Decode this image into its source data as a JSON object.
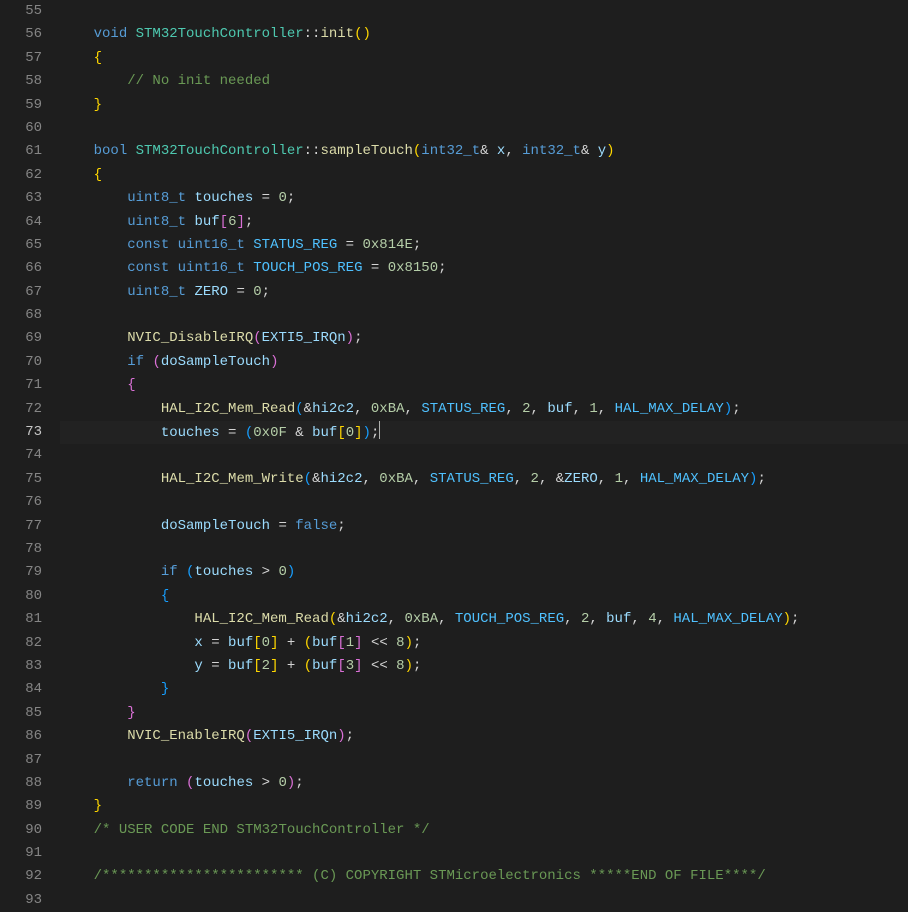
{
  "editor": {
    "startLine": 55,
    "activeLine": 73,
    "lines": [
      {
        "n": 55,
        "tokens": []
      },
      {
        "n": 56,
        "tokens": [
          {
            "t": "    ",
            "c": ""
          },
          {
            "t": "void",
            "c": "kw"
          },
          {
            "t": " ",
            "c": ""
          },
          {
            "t": "STM32TouchController",
            "c": "cls"
          },
          {
            "t": "::",
            "c": "pun"
          },
          {
            "t": "init",
            "c": "fn"
          },
          {
            "t": "()",
            "c": "brace"
          }
        ]
      },
      {
        "n": 57,
        "tokens": [
          {
            "t": "    ",
            "c": ""
          },
          {
            "t": "{",
            "c": "brace"
          }
        ]
      },
      {
        "n": 58,
        "tokens": [
          {
            "t": "        ",
            "c": ""
          },
          {
            "t": "// No init needed",
            "c": "com"
          }
        ]
      },
      {
        "n": 59,
        "tokens": [
          {
            "t": "    ",
            "c": ""
          },
          {
            "t": "}",
            "c": "brace"
          }
        ]
      },
      {
        "n": 60,
        "tokens": []
      },
      {
        "n": 61,
        "tokens": [
          {
            "t": "    ",
            "c": ""
          },
          {
            "t": "bool",
            "c": "kw"
          },
          {
            "t": " ",
            "c": ""
          },
          {
            "t": "STM32TouchController",
            "c": "cls"
          },
          {
            "t": "::",
            "c": "pun"
          },
          {
            "t": "sampleTouch",
            "c": "fn"
          },
          {
            "t": "(",
            "c": "brace"
          },
          {
            "t": "int32_t",
            "c": "type"
          },
          {
            "t": "&",
            "c": "op"
          },
          {
            "t": " ",
            "c": ""
          },
          {
            "t": "x",
            "c": "var"
          },
          {
            "t": ", ",
            "c": "pun"
          },
          {
            "t": "int32_t",
            "c": "type"
          },
          {
            "t": "&",
            "c": "op"
          },
          {
            "t": " ",
            "c": ""
          },
          {
            "t": "y",
            "c": "var"
          },
          {
            "t": ")",
            "c": "brace"
          }
        ]
      },
      {
        "n": 62,
        "tokens": [
          {
            "t": "    ",
            "c": ""
          },
          {
            "t": "{",
            "c": "brace"
          }
        ]
      },
      {
        "n": 63,
        "tokens": [
          {
            "t": "        ",
            "c": ""
          },
          {
            "t": "uint8_t",
            "c": "type"
          },
          {
            "t": " ",
            "c": ""
          },
          {
            "t": "touches",
            "c": "var"
          },
          {
            "t": " = ",
            "c": "op"
          },
          {
            "t": "0",
            "c": "num"
          },
          {
            "t": ";",
            "c": "pun"
          }
        ]
      },
      {
        "n": 64,
        "tokens": [
          {
            "t": "        ",
            "c": ""
          },
          {
            "t": "uint8_t",
            "c": "type"
          },
          {
            "t": " ",
            "c": ""
          },
          {
            "t": "buf",
            "c": "var"
          },
          {
            "t": "[",
            "c": "brace2"
          },
          {
            "t": "6",
            "c": "num"
          },
          {
            "t": "]",
            "c": "brace2"
          },
          {
            "t": ";",
            "c": "pun"
          }
        ]
      },
      {
        "n": 65,
        "tokens": [
          {
            "t": "        ",
            "c": ""
          },
          {
            "t": "const",
            "c": "kw"
          },
          {
            "t": " ",
            "c": ""
          },
          {
            "t": "uint16_t",
            "c": "type"
          },
          {
            "t": " ",
            "c": ""
          },
          {
            "t": "STATUS_REG",
            "c": "const"
          },
          {
            "t": " = ",
            "c": "op"
          },
          {
            "t": "0x814E",
            "c": "num"
          },
          {
            "t": ";",
            "c": "pun"
          }
        ]
      },
      {
        "n": 66,
        "tokens": [
          {
            "t": "        ",
            "c": ""
          },
          {
            "t": "const",
            "c": "kw"
          },
          {
            "t": " ",
            "c": ""
          },
          {
            "t": "uint16_t",
            "c": "type"
          },
          {
            "t": " ",
            "c": ""
          },
          {
            "t": "TOUCH_POS_REG",
            "c": "const"
          },
          {
            "t": " = ",
            "c": "op"
          },
          {
            "t": "0x8150",
            "c": "num"
          },
          {
            "t": ";",
            "c": "pun"
          }
        ]
      },
      {
        "n": 67,
        "tokens": [
          {
            "t": "        ",
            "c": ""
          },
          {
            "t": "uint8_t",
            "c": "type"
          },
          {
            "t": " ",
            "c": ""
          },
          {
            "t": "ZERO",
            "c": "var"
          },
          {
            "t": " = ",
            "c": "op"
          },
          {
            "t": "0",
            "c": "num"
          },
          {
            "t": ";",
            "c": "pun"
          }
        ]
      },
      {
        "n": 68,
        "tokens": []
      },
      {
        "n": 69,
        "tokens": [
          {
            "t": "        ",
            "c": ""
          },
          {
            "t": "NVIC_DisableIRQ",
            "c": "fn"
          },
          {
            "t": "(",
            "c": "brace2"
          },
          {
            "t": "EXTI5_IRQn",
            "c": "var"
          },
          {
            "t": ")",
            "c": "brace2"
          },
          {
            "t": ";",
            "c": "pun"
          }
        ]
      },
      {
        "n": 70,
        "tokens": [
          {
            "t": "        ",
            "c": ""
          },
          {
            "t": "if",
            "c": "kw"
          },
          {
            "t": " ",
            "c": ""
          },
          {
            "t": "(",
            "c": "brace2"
          },
          {
            "t": "doSampleTouch",
            "c": "var"
          },
          {
            "t": ")",
            "c": "brace2"
          }
        ]
      },
      {
        "n": 71,
        "tokens": [
          {
            "t": "        ",
            "c": ""
          },
          {
            "t": "{",
            "c": "brace2"
          }
        ]
      },
      {
        "n": 72,
        "tokens": [
          {
            "t": "            ",
            "c": ""
          },
          {
            "t": "HAL_I2C_Mem_Read",
            "c": "fn"
          },
          {
            "t": "(",
            "c": "brace3"
          },
          {
            "t": "&",
            "c": "op"
          },
          {
            "t": "hi2c2",
            "c": "var"
          },
          {
            "t": ", ",
            "c": "pun"
          },
          {
            "t": "0xBA",
            "c": "num"
          },
          {
            "t": ", ",
            "c": "pun"
          },
          {
            "t": "STATUS_REG",
            "c": "const"
          },
          {
            "t": ", ",
            "c": "pun"
          },
          {
            "t": "2",
            "c": "num"
          },
          {
            "t": ", ",
            "c": "pun"
          },
          {
            "t": "buf",
            "c": "var"
          },
          {
            "t": ", ",
            "c": "pun"
          },
          {
            "t": "1",
            "c": "num"
          },
          {
            "t": ", ",
            "c": "pun"
          },
          {
            "t": "HAL_MAX_DELAY",
            "c": "const"
          },
          {
            "t": ")",
            "c": "brace3"
          },
          {
            "t": ";",
            "c": "pun"
          }
        ]
      },
      {
        "n": 73,
        "tokens": [
          {
            "t": "            ",
            "c": ""
          },
          {
            "t": "touches",
            "c": "var"
          },
          {
            "t": " = ",
            "c": "op"
          },
          {
            "t": "(",
            "c": "brace3"
          },
          {
            "t": "0x0F",
            "c": "num"
          },
          {
            "t": " & ",
            "c": "op"
          },
          {
            "t": "buf",
            "c": "var"
          },
          {
            "t": "[",
            "c": "brace"
          },
          {
            "t": "0",
            "c": "num"
          },
          {
            "t": "]",
            "c": "brace"
          },
          {
            "t": ")",
            "c": "brace3"
          },
          {
            "t": ";",
            "c": "pun"
          }
        ],
        "cursor": true
      },
      {
        "n": 74,
        "tokens": []
      },
      {
        "n": 75,
        "tokens": [
          {
            "t": "            ",
            "c": ""
          },
          {
            "t": "HAL_I2C_Mem_Write",
            "c": "fn"
          },
          {
            "t": "(",
            "c": "brace3"
          },
          {
            "t": "&",
            "c": "op"
          },
          {
            "t": "hi2c2",
            "c": "var"
          },
          {
            "t": ", ",
            "c": "pun"
          },
          {
            "t": "0xBA",
            "c": "num"
          },
          {
            "t": ", ",
            "c": "pun"
          },
          {
            "t": "STATUS_REG",
            "c": "const"
          },
          {
            "t": ", ",
            "c": "pun"
          },
          {
            "t": "2",
            "c": "num"
          },
          {
            "t": ", ",
            "c": "pun"
          },
          {
            "t": "&",
            "c": "op"
          },
          {
            "t": "ZERO",
            "c": "var"
          },
          {
            "t": ", ",
            "c": "pun"
          },
          {
            "t": "1",
            "c": "num"
          },
          {
            "t": ", ",
            "c": "pun"
          },
          {
            "t": "HAL_MAX_DELAY",
            "c": "const"
          },
          {
            "t": ")",
            "c": "brace3"
          },
          {
            "t": ";",
            "c": "pun"
          }
        ]
      },
      {
        "n": 76,
        "tokens": []
      },
      {
        "n": 77,
        "tokens": [
          {
            "t": "            ",
            "c": ""
          },
          {
            "t": "doSampleTouch",
            "c": "var"
          },
          {
            "t": " = ",
            "c": "op"
          },
          {
            "t": "false",
            "c": "kw"
          },
          {
            "t": ";",
            "c": "pun"
          }
        ]
      },
      {
        "n": 78,
        "tokens": []
      },
      {
        "n": 79,
        "tokens": [
          {
            "t": "            ",
            "c": ""
          },
          {
            "t": "if",
            "c": "kw"
          },
          {
            "t": " ",
            "c": ""
          },
          {
            "t": "(",
            "c": "brace3"
          },
          {
            "t": "touches",
            "c": "var"
          },
          {
            "t": " > ",
            "c": "op"
          },
          {
            "t": "0",
            "c": "num"
          },
          {
            "t": ")",
            "c": "brace3"
          }
        ]
      },
      {
        "n": 80,
        "tokens": [
          {
            "t": "            ",
            "c": ""
          },
          {
            "t": "{",
            "c": "brace3"
          }
        ]
      },
      {
        "n": 81,
        "tokens": [
          {
            "t": "                ",
            "c": ""
          },
          {
            "t": "HAL_I2C_Mem_Read",
            "c": "fn"
          },
          {
            "t": "(",
            "c": "brace"
          },
          {
            "t": "&",
            "c": "op"
          },
          {
            "t": "hi2c2",
            "c": "var"
          },
          {
            "t": ", ",
            "c": "pun"
          },
          {
            "t": "0xBA",
            "c": "num"
          },
          {
            "t": ", ",
            "c": "pun"
          },
          {
            "t": "TOUCH_POS_REG",
            "c": "const"
          },
          {
            "t": ", ",
            "c": "pun"
          },
          {
            "t": "2",
            "c": "num"
          },
          {
            "t": ", ",
            "c": "pun"
          },
          {
            "t": "buf",
            "c": "var"
          },
          {
            "t": ", ",
            "c": "pun"
          },
          {
            "t": "4",
            "c": "num"
          },
          {
            "t": ", ",
            "c": "pun"
          },
          {
            "t": "HAL_MAX_DELAY",
            "c": "const"
          },
          {
            "t": ")",
            "c": "brace"
          },
          {
            "t": ";",
            "c": "pun"
          }
        ]
      },
      {
        "n": 82,
        "tokens": [
          {
            "t": "                ",
            "c": ""
          },
          {
            "t": "x",
            "c": "var"
          },
          {
            "t": " = ",
            "c": "op"
          },
          {
            "t": "buf",
            "c": "var"
          },
          {
            "t": "[",
            "c": "brace"
          },
          {
            "t": "0",
            "c": "num"
          },
          {
            "t": "]",
            "c": "brace"
          },
          {
            "t": " + ",
            "c": "op"
          },
          {
            "t": "(",
            "c": "brace"
          },
          {
            "t": "buf",
            "c": "var"
          },
          {
            "t": "[",
            "c": "brace2"
          },
          {
            "t": "1",
            "c": "num"
          },
          {
            "t": "]",
            "c": "brace2"
          },
          {
            "t": " << ",
            "c": "op"
          },
          {
            "t": "8",
            "c": "num"
          },
          {
            "t": ")",
            "c": "brace"
          },
          {
            "t": ";",
            "c": "pun"
          }
        ]
      },
      {
        "n": 83,
        "tokens": [
          {
            "t": "                ",
            "c": ""
          },
          {
            "t": "y",
            "c": "var"
          },
          {
            "t": " = ",
            "c": "op"
          },
          {
            "t": "buf",
            "c": "var"
          },
          {
            "t": "[",
            "c": "brace"
          },
          {
            "t": "2",
            "c": "num"
          },
          {
            "t": "]",
            "c": "brace"
          },
          {
            "t": " + ",
            "c": "op"
          },
          {
            "t": "(",
            "c": "brace"
          },
          {
            "t": "buf",
            "c": "var"
          },
          {
            "t": "[",
            "c": "brace2"
          },
          {
            "t": "3",
            "c": "num"
          },
          {
            "t": "]",
            "c": "brace2"
          },
          {
            "t": " << ",
            "c": "op"
          },
          {
            "t": "8",
            "c": "num"
          },
          {
            "t": ")",
            "c": "brace"
          },
          {
            "t": ";",
            "c": "pun"
          }
        ]
      },
      {
        "n": 84,
        "tokens": [
          {
            "t": "            ",
            "c": ""
          },
          {
            "t": "}",
            "c": "brace3"
          }
        ]
      },
      {
        "n": 85,
        "tokens": [
          {
            "t": "        ",
            "c": ""
          },
          {
            "t": "}",
            "c": "brace2"
          }
        ]
      },
      {
        "n": 86,
        "tokens": [
          {
            "t": "        ",
            "c": ""
          },
          {
            "t": "NVIC_EnableIRQ",
            "c": "fn"
          },
          {
            "t": "(",
            "c": "brace2"
          },
          {
            "t": "EXTI5_IRQn",
            "c": "var"
          },
          {
            "t": ")",
            "c": "brace2"
          },
          {
            "t": ";",
            "c": "pun"
          }
        ]
      },
      {
        "n": 87,
        "tokens": []
      },
      {
        "n": 88,
        "tokens": [
          {
            "t": "        ",
            "c": ""
          },
          {
            "t": "return",
            "c": "kw"
          },
          {
            "t": " ",
            "c": ""
          },
          {
            "t": "(",
            "c": "brace2"
          },
          {
            "t": "touches",
            "c": "var"
          },
          {
            "t": " > ",
            "c": "op"
          },
          {
            "t": "0",
            "c": "num"
          },
          {
            "t": ")",
            "c": "brace2"
          },
          {
            "t": ";",
            "c": "pun"
          }
        ]
      },
      {
        "n": 89,
        "tokens": [
          {
            "t": "    ",
            "c": ""
          },
          {
            "t": "}",
            "c": "brace"
          }
        ]
      },
      {
        "n": 90,
        "tokens": [
          {
            "t": "    ",
            "c": ""
          },
          {
            "t": "/* USER CODE END STM32TouchController */",
            "c": "com"
          }
        ]
      },
      {
        "n": 91,
        "tokens": []
      },
      {
        "n": 92,
        "tokens": [
          {
            "t": "    ",
            "c": ""
          },
          {
            "t": "/************************ (C) COPYRIGHT STMicroelectronics *****END OF FILE****/",
            "c": "com"
          }
        ]
      },
      {
        "n": 93,
        "tokens": []
      }
    ]
  }
}
